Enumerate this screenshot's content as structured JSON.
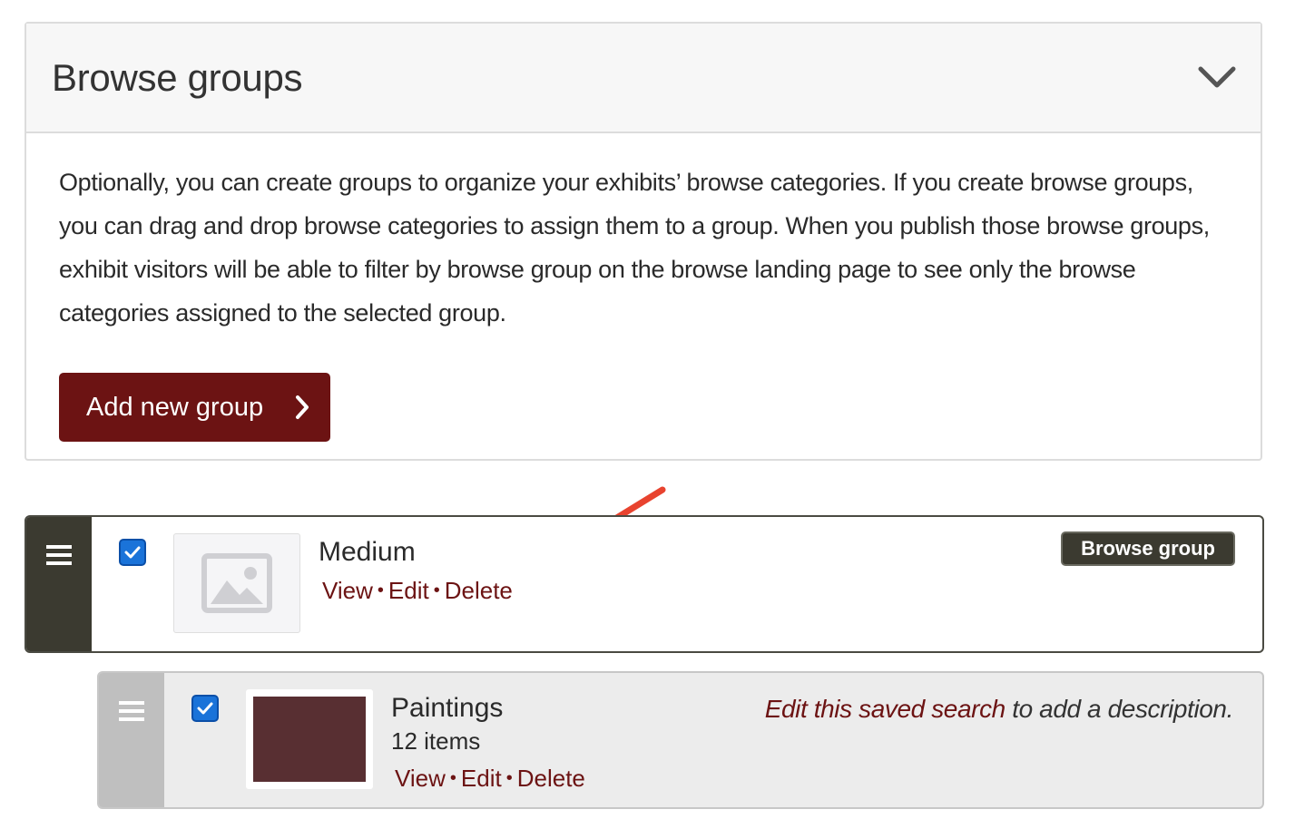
{
  "panel": {
    "title": "Browse groups",
    "description": "Optionally, you can create groups to organize your exhibits’ browse categories. If you create browse groups, you can drag and drop browse categories to assign them to a group. When you publish those browse groups, exhibit visitors will be able to filter by browse group on the browse landing page to see only the browse categories assigned to the selected group.",
    "add_button_label": "Add new group",
    "toggle_icon": "chevron-down-icon"
  },
  "group_row": {
    "title": "Medium",
    "checked": true,
    "actions": {
      "view": "View",
      "edit": "Edit",
      "delete": "Delete",
      "separator": "•"
    },
    "badge": "Browse group",
    "thumbnail_icon": "image-placeholder-icon"
  },
  "category_row": {
    "title": "Paintings",
    "count": "12 items",
    "checked": true,
    "actions": {
      "view": "View",
      "edit": "Edit",
      "delete": "Delete",
      "separator": "•"
    },
    "description_link": "Edit this saved search",
    "description_rest": " to add a description.",
    "thumbnail_color": "#582f32"
  },
  "colors": {
    "brand": "#6c1313",
    "handle_dark": "#3b3a30",
    "handle_light": "#bfbfbf",
    "checkbox": "#1a73d9",
    "annotation_arrow": "#e8432f"
  }
}
